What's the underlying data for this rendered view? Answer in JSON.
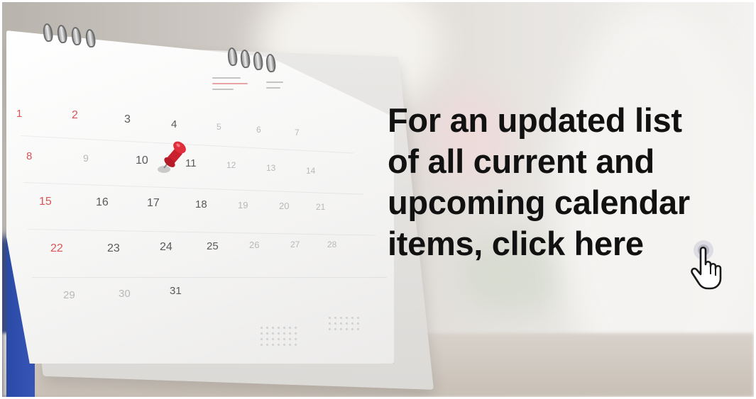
{
  "banner": {
    "headline_lines": [
      "For an updated list",
      "of all current and",
      "upcoming calendar",
      "items, click here"
    ],
    "accent_color": "#d32f3a",
    "text_color": "#111111"
  },
  "calendar": {
    "rows": [
      [
        "1",
        "2",
        "3",
        "4",
        "5",
        "6",
        "7"
      ],
      [
        "8",
        "9",
        "10",
        "11",
        "12",
        "13",
        "14"
      ],
      [
        "15",
        "16",
        "17",
        "18",
        "19",
        "20",
        "21"
      ],
      [
        "22",
        "23",
        "24",
        "25",
        "26",
        "27",
        "28"
      ],
      [
        "29",
        "30",
        "31"
      ]
    ],
    "pinned_day": "10"
  },
  "icons": {
    "pin": "push-pin-icon",
    "cursor": "hand-pointer-icon"
  }
}
